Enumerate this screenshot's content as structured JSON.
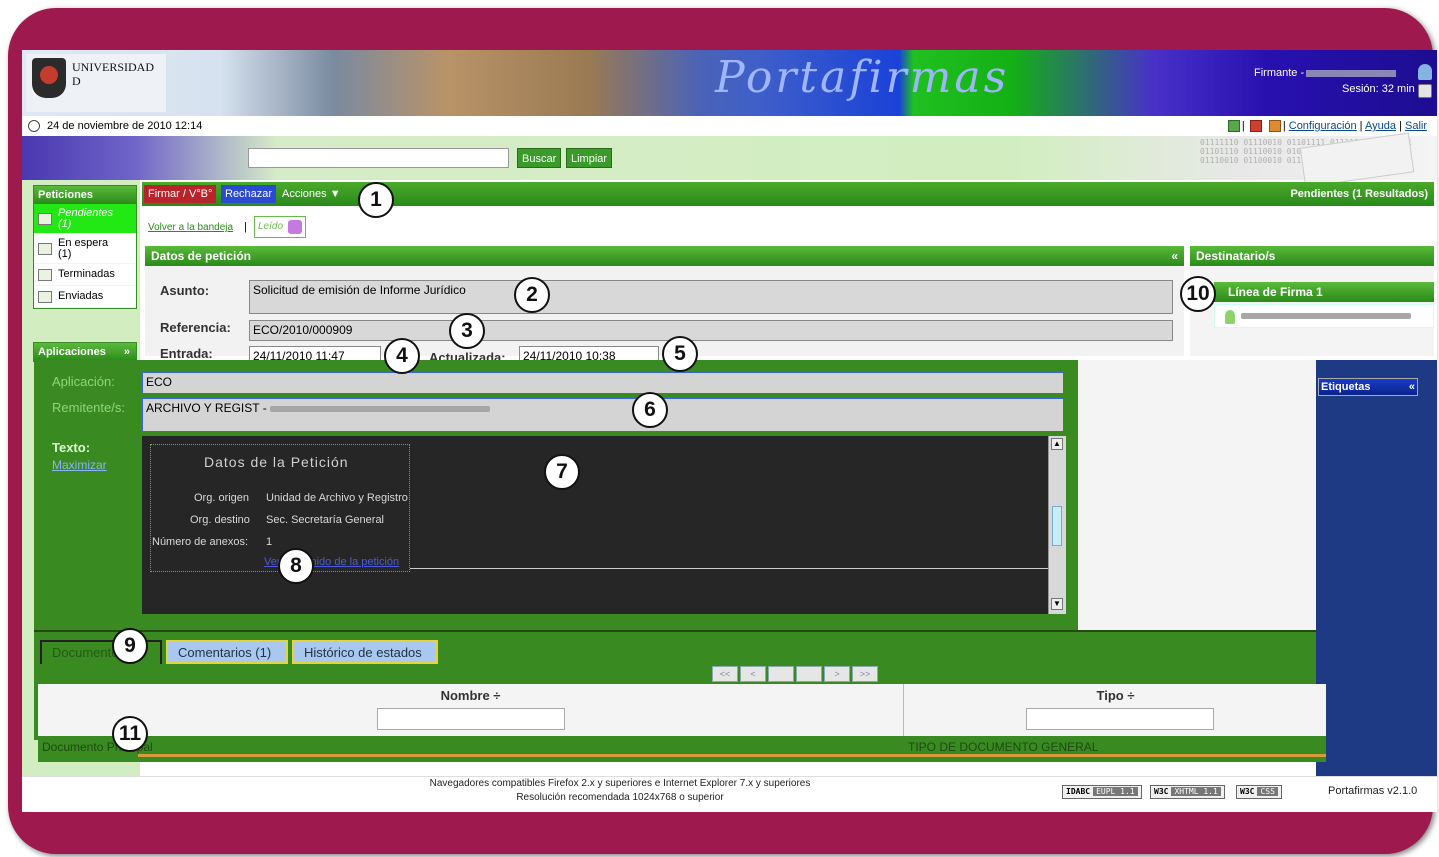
{
  "header": {
    "university": "UNIVERSIDAD",
    "university_line2": "D",
    "portafirmas_logo": "Portafirmas",
    "firmante_label": "Firmante -",
    "session": "Sesión: 32 min"
  },
  "daterow": {
    "date": "24 de noviembre de 2010 12:14",
    "links": [
      "Configuración",
      "Ayuda",
      "Salir"
    ]
  },
  "search": {
    "value": "",
    "buscar_label": "Buscar",
    "limpiar_label": "Limpiar",
    "binary_text": "01111110 01110010 01101111 01111001 01110101 01101110 01110010 01010110 01101101 01101001 01110010 01100010 01110000"
  },
  "sidebar": {
    "peticiones_title": "Peticiones",
    "items": [
      {
        "label": "Pendientes",
        "count": "(1)",
        "active": true
      },
      {
        "label": "En espera",
        "count": "(1)",
        "active": false
      },
      {
        "label": "Terminadas",
        "count": "",
        "active": false
      },
      {
        "label": "Enviadas",
        "count": "",
        "active": false
      }
    ],
    "aplicaciones_title": "Aplicaciones",
    "aplicaciones_chevron": "»"
  },
  "toolbar": {
    "firmar_label": "Firmar / V°B°",
    "rechazar_label": "Rechazar",
    "acciones_label": "Acciones ▼",
    "pendientes_summary": "Pendientes (1 Resultados)",
    "volver_label": "Volver a la bandeja",
    "leido_label": "Leído"
  },
  "datos_peticion": {
    "title": "Datos de petición",
    "collapse": "«",
    "asunto_label": "Asunto:",
    "asunto_value": "Solicitud de emisión de Informe Jurídico",
    "referencia_label": "Referencia:",
    "referencia_value": "ECO/2010/000909",
    "entrada_label": "Entrada:",
    "entrada_value": "24/11/2010 11:47",
    "actualizada_label": "Actualizada:",
    "actualizada_value": "24/11/2010 10:38",
    "aplicacion_label": "Aplicación:",
    "aplicacion_value": "ECO",
    "remitente_label": "Remitente/s:",
    "remitente_value": "ARCHIVO Y REGIST - ",
    "texto_label": "Texto:",
    "maximizar_label": "Maximizar"
  },
  "texto_content": {
    "title": "Datos de la Petición",
    "row1_label": "Org. origen",
    "row1_value": "Unidad de Archivo y Registro",
    "row2_label": "Org. destino",
    "row2_value": "Sec. Secretaría General",
    "row3_label": "Número de anexos:",
    "row3_value": "1",
    "link_text": "Ver contenido de la petición"
  },
  "destinatarios": {
    "title": "Destinatario/s",
    "linea_title": "Línea de Firma 1"
  },
  "etiquetas": {
    "title": "Etiquetas",
    "chevron": "«"
  },
  "tabs": [
    {
      "label": "Documentos"
    },
    {
      "label": "Comentarios (1)"
    },
    {
      "label": "Histórico de estados"
    }
  ],
  "pager": [
    "<<",
    "<",
    "",
    "",
    ">",
    ">>"
  ],
  "documents": {
    "columns": [
      "Nombre ÷",
      "Tipo ÷"
    ],
    "row": {
      "nombre": "Documento Principal",
      "tipo": "TIPO DE DOCUMENTO GENERAL"
    }
  },
  "footer": {
    "line1": "Navegadores compatibles Firefox 2.x y superiores e Internet Explorer 7.x y superiores",
    "line2": "Resolución recomendada 1024x768 o superior",
    "badges": [
      {
        "left": "IDABC",
        "right": "EUPL 1.1"
      },
      {
        "left": "W3C",
        "right": "XHTML 1.1"
      },
      {
        "left": "W3C",
        "right": "CSS"
      }
    ],
    "version": "Portafirmas v2.1.0"
  },
  "callouts": [
    "1",
    "2",
    "3",
    "4",
    "5",
    "6",
    "7",
    "8",
    "9",
    "10",
    "11"
  ]
}
